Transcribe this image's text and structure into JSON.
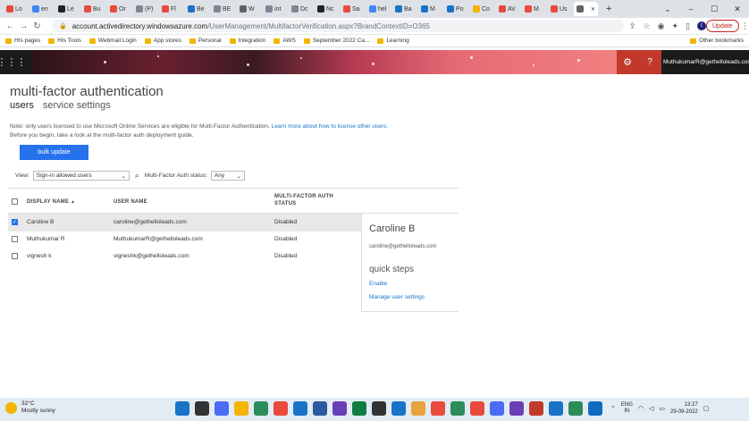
{
  "browser": {
    "tabs": [
      {
        "label": "Lo",
        "color": "#e84a3c"
      },
      {
        "label": "en",
        "color": "#4285f4"
      },
      {
        "label": "Le",
        "color": "#222222"
      },
      {
        "label": "Bu",
        "color": "#e84a3c"
      },
      {
        "label": "Or",
        "color": "#e84a3c"
      },
      {
        "label": "(P)",
        "color": "#7b8794"
      },
      {
        "label": "Fl",
        "color": "#e84a3c"
      },
      {
        "label": "Be",
        "color": "#1a73c8"
      },
      {
        "label": "BE",
        "color": "#7b8794"
      },
      {
        "label": "W",
        "color": "#5f6368"
      },
      {
        "label": "int",
        "color": "#7b8794"
      },
      {
        "label": "Dc",
        "color": "#7b8794"
      },
      {
        "label": "Nc",
        "color": "#222222"
      },
      {
        "label": "Sa",
        "color": "#e84a3c"
      },
      {
        "label": "hel",
        "color": "#4285f4"
      },
      {
        "label": "Ba",
        "color": "#1a73c8"
      },
      {
        "label": "M",
        "color": "#1a73c8"
      },
      {
        "label": "Po",
        "color": "#1a73c8"
      },
      {
        "label": "Co",
        "color": "#f4b400"
      },
      {
        "label": "AV",
        "color": "#e84a3c"
      },
      {
        "label": "M",
        "color": "#e84a3c"
      },
      {
        "label": "Us",
        "color": "#e84a3c"
      },
      {
        "label": "",
        "color": "#5f6368",
        "active": true
      }
    ],
    "new_tab": "+",
    "url_host": "account.activedirectory.windowsazure.com",
    "url_path": "/UserManagement/MultifactorVerification.aspx?BrandContextID=O365",
    "profile_initial": "t",
    "update_label": "Update",
    "bookmarks": [
      "HIs pages",
      "HIs Tools",
      "Webmail Login",
      "App stores",
      "Personal",
      "Integration",
      "AWS",
      "September 2022 Ca...",
      "Learning"
    ],
    "other_bookmarks": "Other bookmarks"
  },
  "header": {
    "user": "MuthukumarR@gethelloleads.com",
    "help": "?"
  },
  "page": {
    "title": "multi-factor authentication",
    "tab_users": "users",
    "tab_service": "service settings",
    "note_line1": "Note: only users licensed to use Microsoft Online Services are eligible for Multi-Factor Authentication.",
    "note_link": "Learn more about how to license other users.",
    "note_line2": "Before you begin, take a look at the multi-factor auth deployment guide.",
    "bulk_update": "bulk update",
    "view_label": "View:",
    "view_value": "Sign-in allowed users",
    "mfa_label": "Multi-Factor Auth status:",
    "mfa_value": "Any"
  },
  "table": {
    "col_display": "DISPLAY NAME",
    "sort_arrow": "▲",
    "col_user": "USER NAME",
    "col_mfa_1": "MULTI-FACTOR AUTH",
    "col_mfa_2": "STATUS",
    "rows": [
      {
        "display": "Caroline B",
        "user": "caroline@gethelloleads.com",
        "status": "Disabled",
        "checked": true
      },
      {
        "display": "Muthukumar R",
        "user": "MuthukumarR@gethelloleads.com",
        "status": "Disabled",
        "checked": false
      },
      {
        "display": "vignesh k",
        "user": "vigneshk@gethelloleads.com",
        "status": "Disabled",
        "checked": false
      }
    ]
  },
  "detail": {
    "name": "Caroline B",
    "email": "caroline@gethelloleads.com",
    "quick_steps": "quick steps",
    "enable": "Enable",
    "manage": "Manage user settings"
  },
  "taskbar": {
    "temp": "32°C",
    "weather": "Mostly sunny",
    "lang1": "ENG",
    "lang2": "IN",
    "time": "13:27",
    "date": "29-09-2022",
    "apps": [
      "#1a73c8",
      "#333333",
      "#4a6cf7",
      "#f4b400",
      "#2c8c5a",
      "#e84a3c",
      "#1a73c8",
      "#2c5aa0",
      "#6a3fb5",
      "#107c41",
      "#333333",
      "#1a73c8",
      "#e8a33c",
      "#e84a3c",
      "#2c8c5a",
      "#e84a3c",
      "#4a6cf7",
      "#6a3fb5",
      "#c0392b",
      "#1a73c8",
      "#2c8c5a",
      "#0f6cbd"
    ]
  },
  "colors": {
    "accent": "#2672ec",
    "header_red": "#c0392b",
    "link": "#1a73c8"
  }
}
